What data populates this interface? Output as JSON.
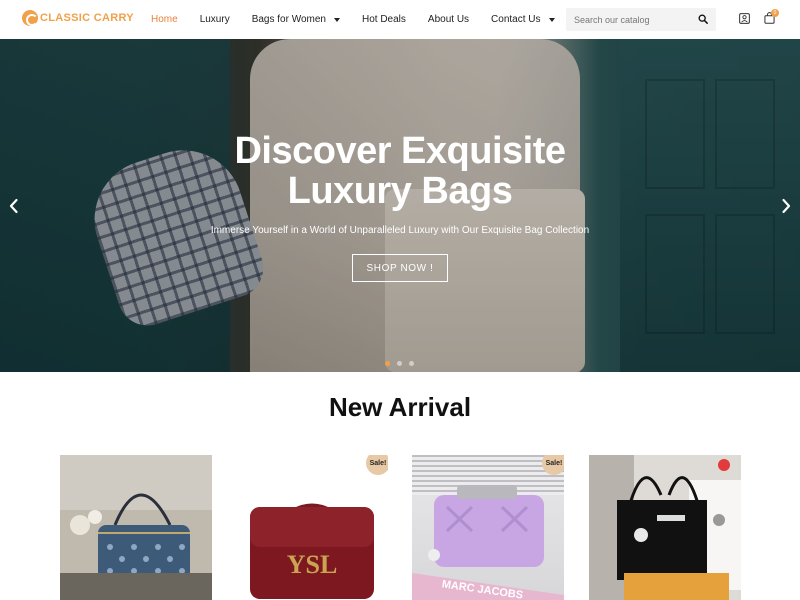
{
  "header": {
    "logo_text": "CLASSIC CARRY",
    "nav": [
      {
        "label": "Home",
        "active": true
      },
      {
        "label": "Luxury"
      },
      {
        "label": "Bags for Women",
        "dropdown": true
      },
      {
        "label": "Hot Deals"
      },
      {
        "label": "About Us"
      },
      {
        "label": "Contact Us",
        "dropdown": true
      }
    ],
    "search_placeholder": "Search our catalog",
    "cart_count": "0"
  },
  "hero": {
    "title_line1": "Discover Exquisite",
    "title_line2": "Luxury Bags",
    "subtitle": "Immerse Yourself in a World of Unparalleled Luxury with Our Exquisite Bag Collection",
    "cta": "SHOP NOW !",
    "slides_total": 3,
    "active_slide": 1
  },
  "arrivals": {
    "title": "New Arrival",
    "products": [
      {
        "sale": false
      },
      {
        "sale": true,
        "badge": "Sale!"
      },
      {
        "sale": true,
        "badge": "Sale!"
      },
      {
        "sale": false
      }
    ]
  },
  "colors": {
    "accent": "#f0a14a",
    "active_nav": "#e8823c",
    "badge": "#e8c9a6"
  }
}
